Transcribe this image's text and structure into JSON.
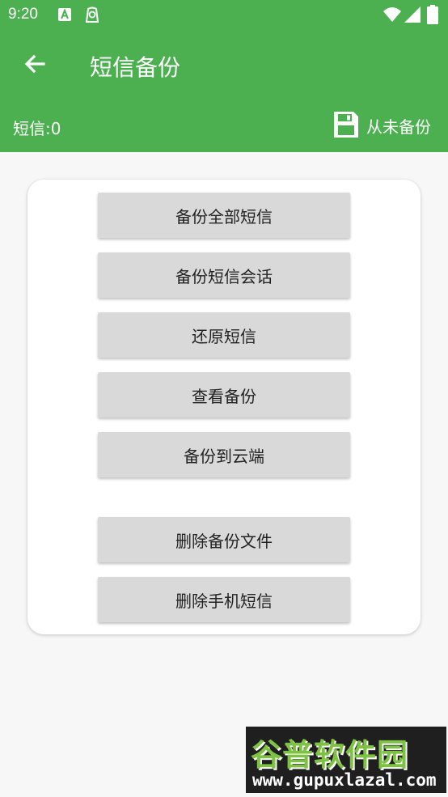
{
  "status_bar": {
    "time": "9:20"
  },
  "app_bar": {
    "title": "短信备份",
    "sms_count": "短信:0",
    "backup_status": "从未备份"
  },
  "actions": [
    {
      "label": "备份全部短信"
    },
    {
      "label": "备份短信会话"
    },
    {
      "label": "还原短信"
    },
    {
      "label": "查看备份"
    },
    {
      "label": "备份到云端"
    },
    {
      "label": "删除备份文件"
    },
    {
      "label": "删除手机短信"
    }
  ],
  "watermark": {
    "logo": "谷普软件园",
    "url": "www.gupuxlazal.com"
  },
  "colors": {
    "primary": "#4caf50",
    "button": "#d9d9d9",
    "background": "#f7f7f7"
  },
  "icons": [
    "back-arrow-icon",
    "floppy-disk-icon",
    "wifi-icon",
    "signal-icon",
    "battery-icon"
  ]
}
